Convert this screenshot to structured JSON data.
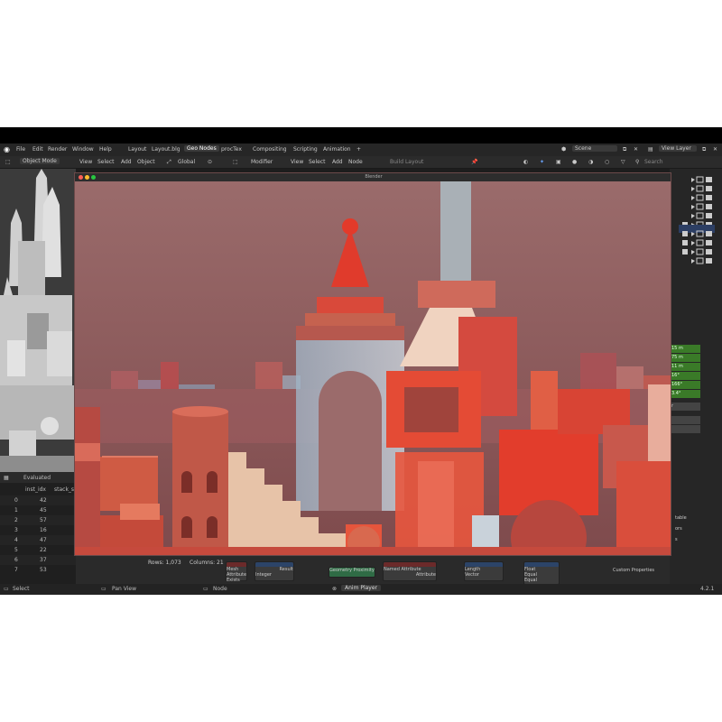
{
  "topbar": {
    "menus": [
      "File",
      "Edit",
      "Render",
      "Window",
      "Help"
    ],
    "workspaces": [
      "Layout",
      "Layout.blg",
      "Geo Nodes",
      "procTex",
      "Compositing",
      "Scripting",
      "Animation"
    ],
    "active_workspace": "Geo Nodes",
    "add_tab": "+",
    "scene": "Scene",
    "view_layer": "View Layer"
  },
  "header": {
    "mode": "Object Mode",
    "menus": [
      "View",
      "Select",
      "Add",
      "Object"
    ],
    "orientation": "Global",
    "modifier": "Modifier",
    "node_menus": [
      "View",
      "Select",
      "Add",
      "Node"
    ],
    "build_layout": "Build Layout",
    "search_placeholder": "Search"
  },
  "render_window": {
    "title": "Blender"
  },
  "spreadsheet": {
    "evaluated_label": "Evaluated",
    "columns": [
      "inst_idx",
      "stack_s"
    ],
    "rows": [
      {
        "index": "0",
        "value": "42"
      },
      {
        "index": "1",
        "value": "45"
      },
      {
        "index": "2",
        "value": "57"
      },
      {
        "index": "3",
        "value": "16"
      },
      {
        "index": "4",
        "value": "47"
      },
      {
        "index": "5",
        "value": "22"
      },
      {
        "index": "6",
        "value": "37"
      },
      {
        "index": "7",
        "value": "53"
      }
    ],
    "overflow_row": [
      "745",
      "747",
      "20",
      "226",
      "1"
    ],
    "rows_label": "Rows: 1,073",
    "columns_label": "Columns: 21"
  },
  "properties": {
    "values": [
      "15 m",
      "75 m",
      "11 m",
      "16°",
      "166°",
      "3.4°"
    ],
    "custom_properties": "Custom Properties",
    "cut_labels": [
      "r",
      "table",
      "ors",
      "s"
    ]
  },
  "nodes": {
    "labels": [
      "Mesh",
      "Attribute",
      "Exists",
      "Result",
      "Integer",
      "Geometry Proximity",
      "Named Attribute",
      "Attribute",
      "Length",
      "Vector",
      "Float",
      "Equal",
      "Equal"
    ]
  },
  "statusbar": {
    "select": "Select",
    "pan_view": "Pan View",
    "node": "Node",
    "anim_player": "Anim Player",
    "version": "4.2.1"
  },
  "colors": {
    "sky": "#8a4f52",
    "red": "#d9402f",
    "accent_blue": "#3c6ec8",
    "active_green": "#3a7a28"
  }
}
